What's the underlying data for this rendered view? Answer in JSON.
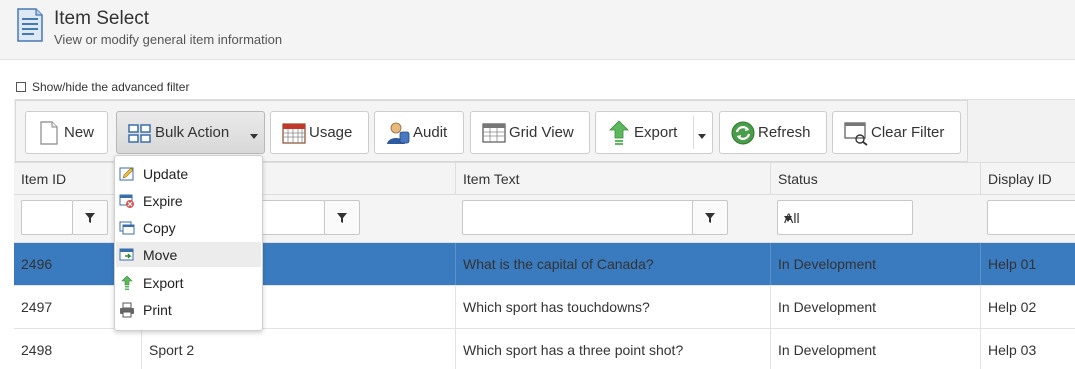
{
  "header": {
    "title": "Item Select",
    "subtitle": "View or modify general item information",
    "icon": "document-list-icon"
  },
  "advanced_filter": {
    "label": "Show/hide the advanced filter",
    "checked": false
  },
  "toolbar": {
    "buttons": [
      {
        "label": "New",
        "icon": "new-document-icon"
      },
      {
        "label": "Bulk Action",
        "icon": "grid-icon",
        "has_dropdown": true,
        "active": true
      },
      {
        "label": "Usage",
        "icon": "calendar-icon"
      },
      {
        "label": "Audit",
        "icon": "user-audit-icon"
      },
      {
        "label": "Grid View",
        "icon": "grid-view-icon"
      },
      {
        "label": "Export",
        "icon": "export-arrow-icon",
        "has_dropdown": true
      },
      {
        "label": "Refresh",
        "icon": "refresh-icon"
      },
      {
        "label": "Clear Filter",
        "icon": "clear-filter-icon"
      }
    ]
  },
  "bulk_menu": {
    "items": [
      {
        "label": "Update",
        "icon": "edit-icon"
      },
      {
        "label": "Expire",
        "icon": "expire-icon"
      },
      {
        "label": "Copy",
        "icon": "copy-icon"
      },
      {
        "label": "Move",
        "icon": "move-icon",
        "hovered": true
      },
      {
        "label": "Export",
        "icon": "export-icon"
      },
      {
        "label": "Print",
        "icon": "print-icon"
      }
    ]
  },
  "grid": {
    "columns": [
      "Item ID",
      "",
      "Item Text",
      "Status",
      "Display ID"
    ],
    "status_filter": "All",
    "rows": [
      {
        "id": "2496",
        "name": "",
        "text": "What is the capital of Canada?",
        "status": "In Development",
        "display_id": "Help 01",
        "selected": true
      },
      {
        "id": "2497",
        "name": "",
        "text": "Which sport has touchdowns?",
        "status": "In Development",
        "display_id": "Help 02",
        "selected": false
      },
      {
        "id": "2498",
        "name": "Sport 2",
        "text": "Which sport has a three point shot?",
        "status": "In Development",
        "display_id": "Help 03",
        "selected": false
      }
    ]
  },
  "colors": {
    "selected_row": "#3a7bbf",
    "header_bg": "#f4f4f4"
  }
}
